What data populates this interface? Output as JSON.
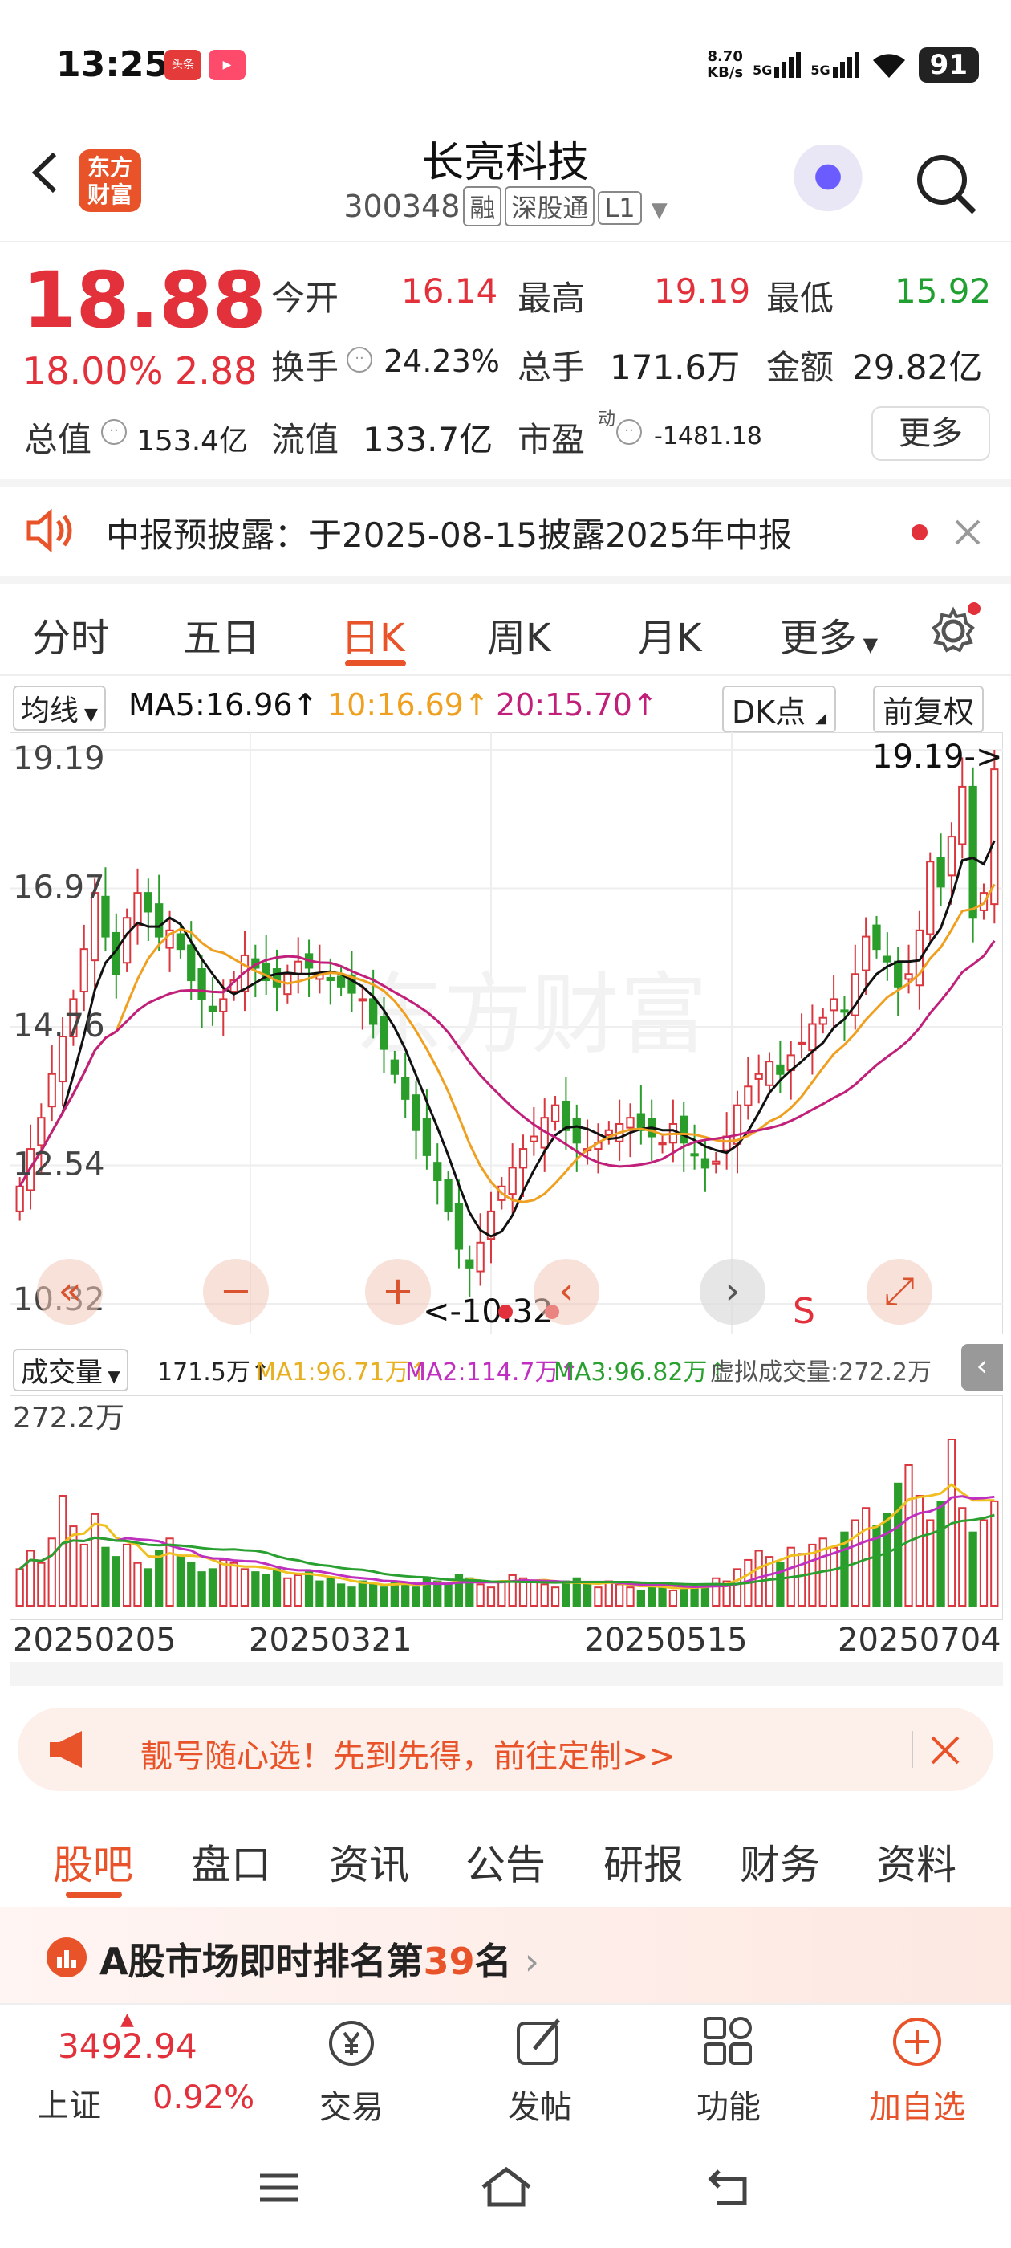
{
  "status": {
    "time": "13:25",
    "app_badge_1": "头条",
    "net_speed": "8.70\nKB/s",
    "net_speed_top": "8.70",
    "net_speed_unit": "KB/s",
    "sig1": "5G",
    "sig2": "5G",
    "battery": "91"
  },
  "header": {
    "title": "长亮科技",
    "code": "300348",
    "tags": [
      "融",
      "深股通",
      "L1"
    ]
  },
  "quote": {
    "price": "18.88",
    "change_pct": "18.00%",
    "change": "2.88",
    "open_label": "今开",
    "open": "16.14",
    "high_label": "最高",
    "high": "19.19",
    "low_label": "最低",
    "low": "15.92",
    "turnover_label": "换手",
    "turnover": "24.23%",
    "volume_label": "总手",
    "volume": "171.6万",
    "amount_label": "金额",
    "amount": "29.82亿",
    "mktcap_label": "总值",
    "mktcap": "153.4亿",
    "float_label": "流值",
    "float": "133.7亿",
    "pe_label": "市盈",
    "pe_sup": "动",
    "pe": "-1481.18",
    "more_label": "更多"
  },
  "notice": {
    "text": "中报预披露：于2025-08-15披露2025年中报"
  },
  "tabs": [
    "分时",
    "五日",
    "日K",
    "周K",
    "月K",
    "更多"
  ],
  "active_tab": "日K",
  "ma": {
    "selector": "均线",
    "ma5": "MA5:16.96",
    "ma10": "10:16.69",
    "ma20": "20:15.70",
    "dk": "DK点",
    "adjust": "前复权",
    "colors": {
      "ma5": "#111111",
      "ma10": "#f0a020",
      "ma20": "#c0207a"
    }
  },
  "chart_data": {
    "type": "candlestick",
    "y_ticks": [
      "19.19",
      "16.97",
      "14.76",
      "12.54",
      "10.32"
    ],
    "ylim": [
      10.32,
      19.19
    ],
    "high_marker": "19.19->",
    "low_marker": "<-10.32",
    "x_ticks": [
      "20250205",
      "20250321",
      "20250515",
      "20250704"
    ],
    "closes": [
      12.2,
      12.8,
      13.3,
      14.0,
      14.6,
      15.2,
      16.0,
      16.9,
      16.2,
      15.6,
      16.5,
      16.9,
      16.6,
      16.2,
      16.3,
      16.0,
      15.5,
      15.2,
      15.0,
      15.2,
      15.5,
      15.9,
      15.7,
      15.5,
      15.4,
      15.6,
      15.8,
      15.7,
      15.6,
      15.5,
      15.4,
      15.3,
      15.2,
      14.8,
      14.4,
      14.0,
      13.6,
      13.1,
      12.7,
      12.3,
      11.8,
      11.2,
      10.9,
      11.3,
      11.8,
      12.2,
      12.5,
      12.8,
      13.0,
      13.3,
      13.5,
      13.1,
      12.9,
      12.8,
      12.9,
      13.1,
      13.2,
      13.3,
      13.1,
      13.0,
      12.9,
      13.2,
      12.9,
      12.7,
      12.5,
      12.6,
      13.0,
      13.5,
      13.8,
      14.0,
      14.2,
      14.0,
      14.3,
      14.5,
      14.8,
      14.9,
      15.2,
      15.0,
      15.6,
      16.2,
      16.0,
      15.8,
      15.4,
      15.6,
      16.3,
      17.4,
      17.0,
      17.8,
      18.6,
      16.5,
      16.9,
      18.88
    ],
    "ma_labels": [
      "MA5",
      "MA10",
      "MA20"
    ]
  },
  "volume": {
    "selector": "成交量",
    "vol": "171.5万",
    "ma1": "MA1:96.71万",
    "ma2": "MA2:114.7万",
    "ma3": "MA3:96.82万",
    "virtual": "虚拟成交量:272.2万",
    "max_label": "272.2万",
    "colors": {
      "ma1": "#f0c020",
      "ma2": "#c030c0",
      "ma3": "#2aa030"
    },
    "values": [
      60,
      90,
      70,
      110,
      180,
      130,
      100,
      150,
      95,
      80,
      100,
      70,
      60,
      90,
      110,
      80,
      70,
      55,
      60,
      75,
      70,
      60,
      55,
      50,
      60,
      45,
      50,
      55,
      40,
      45,
      35,
      30,
      40,
      35,
      30,
      40,
      35,
      30,
      45,
      40,
      35,
      50,
      45,
      35,
      30,
      40,
      50,
      45,
      40,
      35,
      30,
      40,
      45,
      35,
      30,
      40,
      35,
      30,
      25,
      30,
      35,
      25,
      30,
      28,
      35,
      45,
      40,
      60,
      75,
      90,
      80,
      70,
      95,
      85,
      100,
      110,
      95,
      120,
      140,
      160,
      130,
      150,
      200,
      230,
      180,
      140,
      170,
      272,
      160,
      120,
      140,
      171
    ]
  },
  "banner": {
    "text": "靓号随心选！先到先得，前往定制>>"
  },
  "subtabs": [
    "股吧",
    "盘口",
    "资讯",
    "公告",
    "研报",
    "财务",
    "资料"
  ],
  "rank": {
    "prefix": "A股市场即时排名第",
    "num": "39",
    "suffix": "名"
  },
  "nav": {
    "index_value": "3492.94",
    "index_name": "上证",
    "index_pct": "0.92%",
    "trade": "交易",
    "post": "发帖",
    "func": "功能",
    "add": "加自选"
  }
}
